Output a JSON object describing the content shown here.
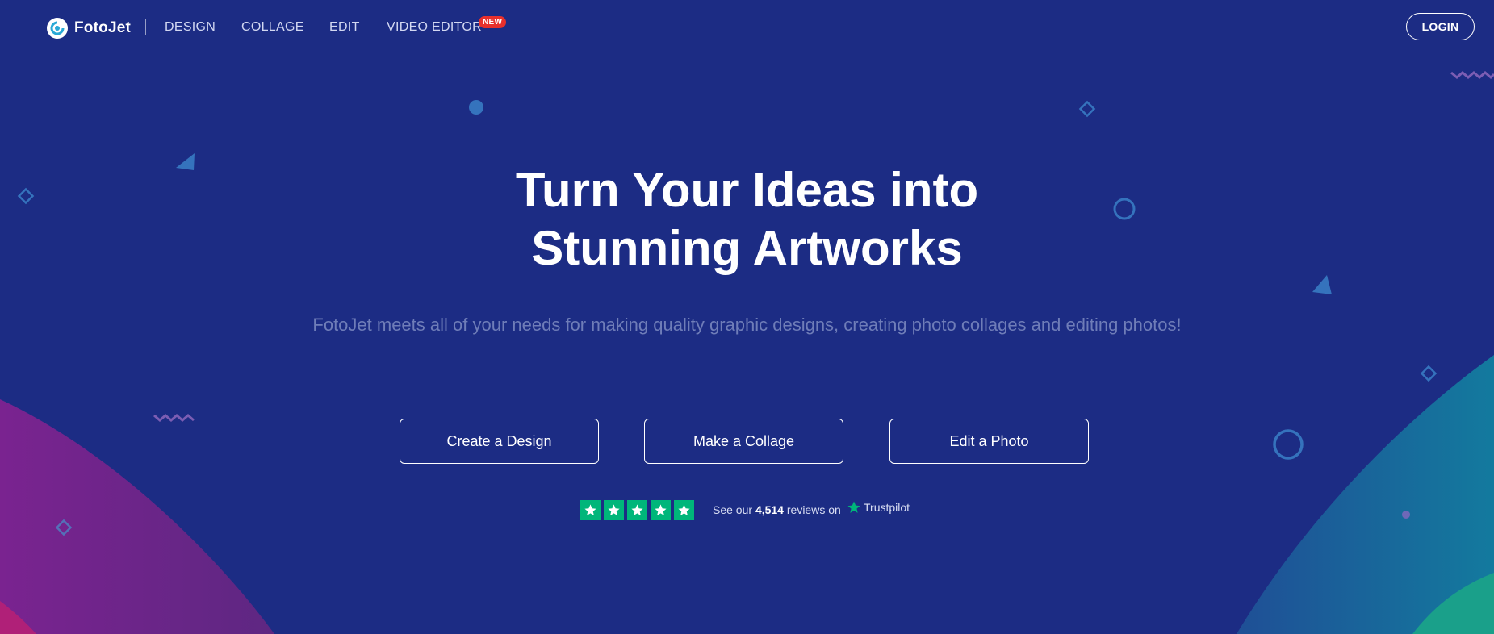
{
  "nav": {
    "brand": "FotoJet",
    "links": [
      "DESIGN",
      "COLLAGE",
      "EDIT",
      "VIDEO EDITOR"
    ],
    "new_badge": "NEW",
    "login": "LOGIN"
  },
  "hero": {
    "title_line1": "Turn Your Ideas into",
    "title_line2": "Stunning Artworks",
    "subtitle": "FotoJet meets all of your needs for making quality graphic designs, creating photo collages and editing photos!"
  },
  "cta": {
    "design": "Create a Design",
    "collage": "Make a Collage",
    "edit": "Edit a Photo"
  },
  "reviews": {
    "prefix": "See our",
    "count": "4,514",
    "suffix": "reviews on",
    "provider": "Trustpilot",
    "stars": 5
  },
  "colors": {
    "background": "#1c2c84",
    "trustpilot_green": "#00b67a",
    "new_badge": "#e8302c"
  }
}
